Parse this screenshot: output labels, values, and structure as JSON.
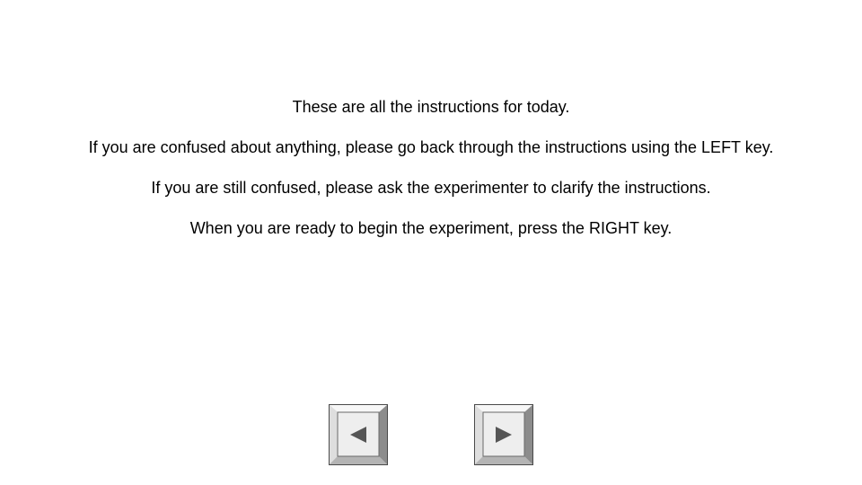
{
  "instructions": [
    "These are all the instructions for today.",
    "If you are confused about anything, please go back through the instructions using the LEFT key.",
    "If you are still confused, please ask the experimenter to clarify the instructions.",
    "When you are ready to begin the experiment, press the RIGHT key."
  ],
  "keys": {
    "left": {
      "icon": "left-arrow-key-icon"
    },
    "right": {
      "icon": "right-arrow-key-icon"
    }
  },
  "colors": {
    "background": "#ffffff",
    "text": "#000000",
    "key_face": "#eeeeee",
    "key_light": "#f7f7f7",
    "key_mid": "#c8c8c8",
    "key_dark": "#8c8c8c",
    "key_border": "#4a4a4a",
    "arrow": "#555555"
  }
}
